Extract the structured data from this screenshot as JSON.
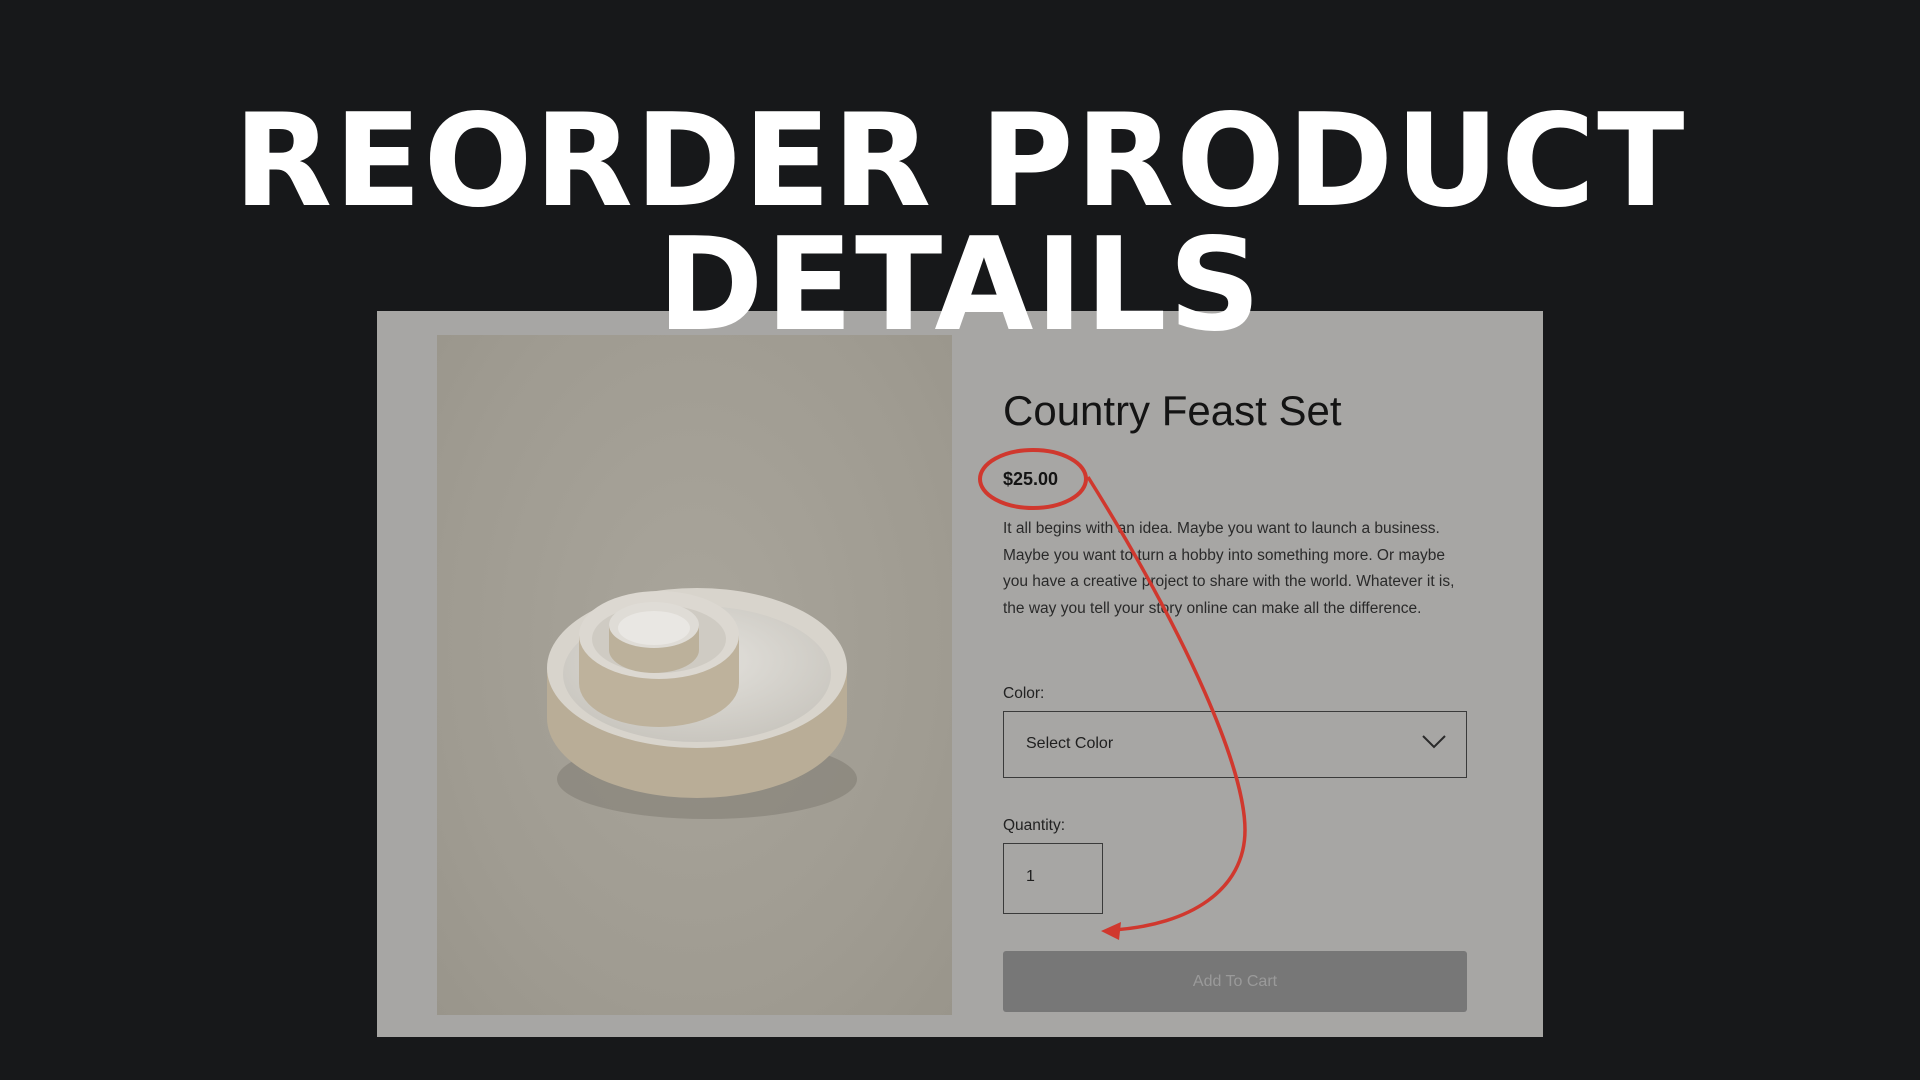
{
  "headline": {
    "line1": "REORDER PRODUCT",
    "line2": "DETAILS"
  },
  "product": {
    "title": "Country Feast Set",
    "price": "$25.00",
    "description": "It all begins with an idea. Maybe you want to launch a business. Maybe you want to turn a hobby into something more. Or maybe you have a creative project to share with the world. Whatever it is, the way you tell your story online can make all the difference.",
    "color_label": "Color:",
    "color_value": "Select Color",
    "quantity_label": "Quantity:",
    "quantity_value": "1",
    "add_to_cart": "Add To Cart"
  },
  "icons": {
    "dropdown": "chevron-down-icon"
  },
  "colors": {
    "background": "#17181a",
    "panel": "#a7a6a4",
    "annotation": "#d0382e",
    "button": "#777777"
  }
}
